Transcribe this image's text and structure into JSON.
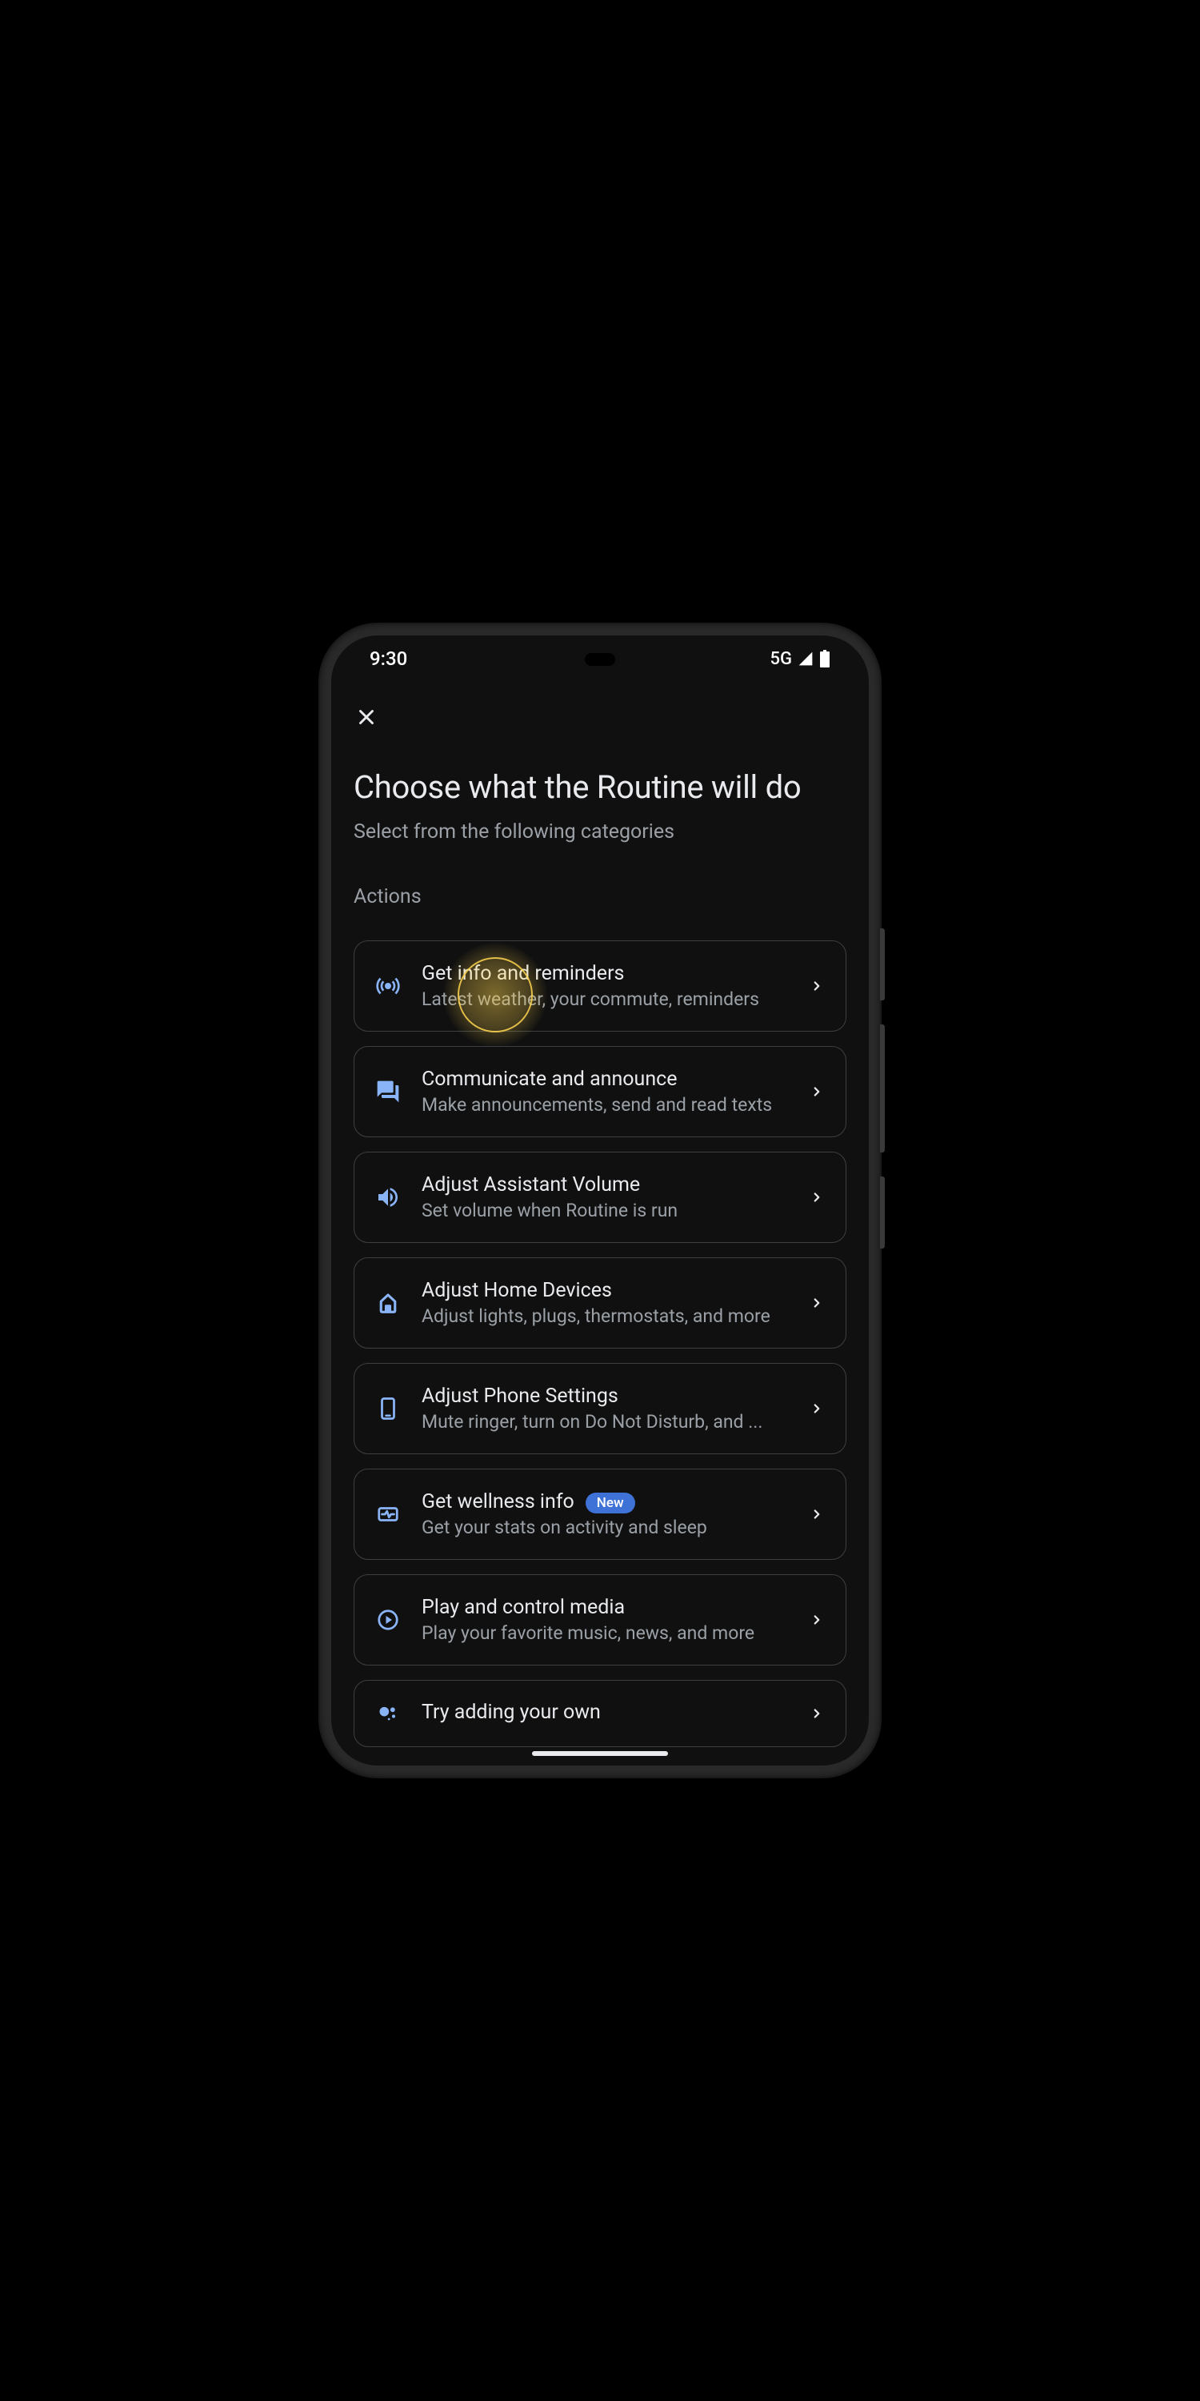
{
  "status": {
    "time": "9:30",
    "network": "5G"
  },
  "header": {
    "title": "Choose what the Routine will do",
    "subtitle": "Select from the following categories"
  },
  "section_label": "Actions",
  "badge_label": "New",
  "actions": [
    {
      "icon": "broadcast-icon",
      "title": "Get info and reminders",
      "subtitle": "Latest weather, your commute, reminders"
    },
    {
      "icon": "chat-icon",
      "title": "Communicate and announce",
      "subtitle": "Make announcements, send and read texts"
    },
    {
      "icon": "volume-icon",
      "title": "Adjust Assistant Volume",
      "subtitle": "Set volume when Routine is run"
    },
    {
      "icon": "home-icon",
      "title": "Adjust Home Devices",
      "subtitle": "Adjust lights, plugs, thermostats, and more"
    },
    {
      "icon": "phone-icon",
      "title": "Adjust Phone Settings",
      "subtitle": "Mute ringer, turn on Do Not Disturb, and ..."
    },
    {
      "icon": "wellness-icon",
      "title": "Get wellness info",
      "subtitle": "Get your stats on activity and sleep",
      "badge": true
    },
    {
      "icon": "play-icon",
      "title": "Play and control media",
      "subtitle": "Play your favorite music, news, and more"
    },
    {
      "icon": "assistant-icon",
      "title": "Try adding your own",
      "subtitle": ""
    }
  ]
}
